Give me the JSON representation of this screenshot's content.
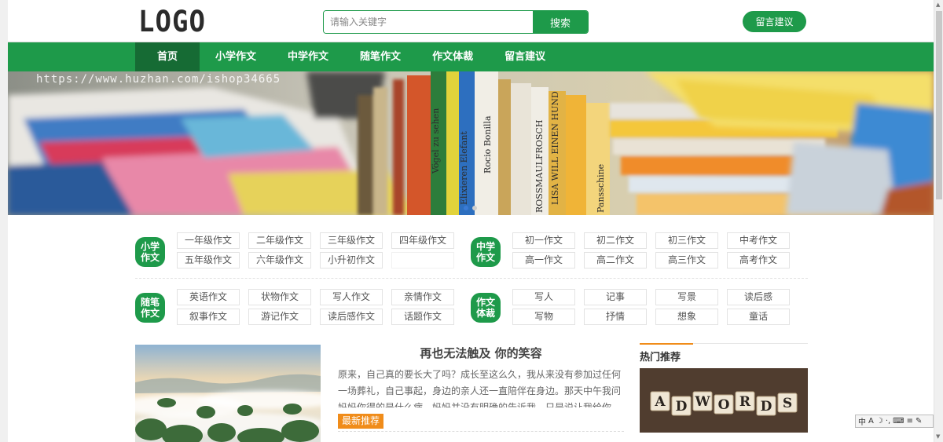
{
  "header": {
    "logo_text": "LOGO",
    "search_placeholder": "请输入关键字",
    "search_button": "搜索",
    "message_button": "留言建议"
  },
  "nav": {
    "items": [
      "首页",
      "小学作文",
      "中学作文",
      "随笔作文",
      "作文体裁",
      "留言建议"
    ],
    "active_index": 0
  },
  "banner": {
    "watermark": "https://www.huzhan.com/ishop34665",
    "slide_count": 2,
    "active_slide": 0
  },
  "categories": {
    "primary": {
      "label": "小学作文",
      "tags": [
        "一年级作文",
        "二年级作文",
        "三年级作文",
        "四年级作文",
        "五年级作文",
        "六年级作文",
        "小升初作文"
      ]
    },
    "middle": {
      "label": "中学作文",
      "tags": [
        "初一作文",
        "初二作文",
        "初三作文",
        "中考作文",
        "高一作文",
        "高二作文",
        "高三作文",
        "高考作文"
      ]
    },
    "essay": {
      "label": "随笔作文",
      "tags": [
        "英语作文",
        "状物作文",
        "写人作文",
        "亲情作文",
        "叙事作文",
        "游记作文",
        "读后感作文",
        "话题作文"
      ]
    },
    "genre": {
      "label": "作文体裁",
      "tags": [
        "写人",
        "记事",
        "写景",
        "读后感",
        "写物",
        "抒情",
        "想象",
        "童话"
      ]
    }
  },
  "featured": {
    "title": "再也无法触及 你的笑容",
    "excerpt": "原来，自己真的要长大了吗？成长至这么久，我从来没有参加过任何一场葬礼，自己事起，身边的亲人还一直陪伴在身边。那天中午我问妈妈你得的是什么病，妈妈并没有明确的告诉我，只是说让我给你打...",
    "tag": "最新推荐"
  },
  "hot": {
    "label": "热门推荐",
    "image_letters": [
      "A",
      "D",
      "W",
      "O",
      "R",
      "D",
      "S"
    ]
  },
  "colors": {
    "brand_green": "#1e9a4a",
    "nav_active": "#166b34",
    "accent_orange": "#f08c1a"
  }
}
